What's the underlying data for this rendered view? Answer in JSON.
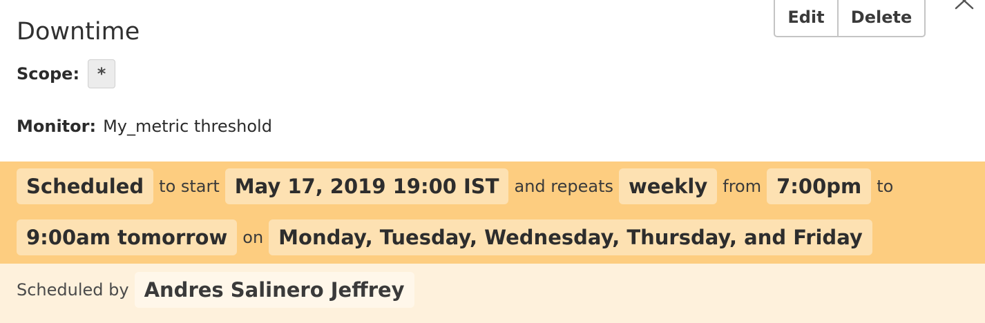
{
  "header": {
    "title": "Downtime",
    "edit_label": "Edit",
    "delete_label": "Delete",
    "close_icon": "close-icon"
  },
  "scope": {
    "label": "Scope:",
    "value": "*"
  },
  "monitor": {
    "label": "Monitor:",
    "value": "My_metric threshold"
  },
  "schedule": {
    "status": "Scheduled",
    "text_start": "to start",
    "start_datetime": "May 17, 2019 19:00 IST",
    "text_repeats": "and repeats",
    "frequency": "weekly",
    "text_from": "from",
    "from_time": "7:00pm",
    "text_to": "to",
    "to_time": "9:00am tomorrow",
    "text_on": "on",
    "days": "Monday, Tuesday, Wednesday, Thursday, and Friday"
  },
  "scheduled_by": {
    "label": "Scheduled by",
    "user": "Andres Salinero Jeffrey"
  },
  "colors": {
    "schedule_band": "#fdcd80",
    "schedule_chip": "#fde1b2",
    "by_band": "#fef1dc"
  }
}
